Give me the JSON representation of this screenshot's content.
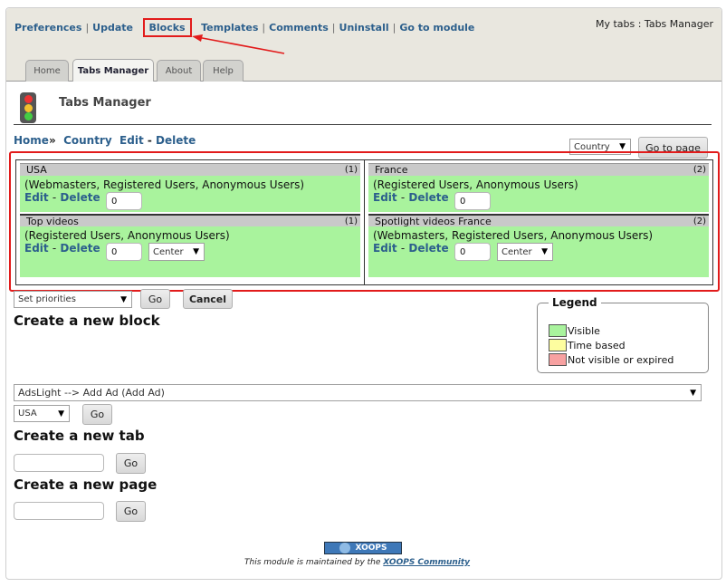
{
  "toplinks": [
    "Preferences",
    "Update",
    "Blocks",
    "Templates",
    "Comments",
    "Uninstall",
    "Go to module"
  ],
  "mytabs": "My tabs : Tabs Manager",
  "tabs": [
    "Home",
    "Tabs Manager",
    "About",
    "Help"
  ],
  "page_title": "Tabs Manager",
  "breadcrumb": {
    "home": "Home",
    "sep": "»",
    "country": "Country",
    "edit": "Edit",
    "dash": "-",
    "delete": "Delete"
  },
  "go_select": {
    "value": "Country",
    "button": "Go to page"
  },
  "blocks": {
    "left": [
      {
        "name": "USA",
        "count": "(1)",
        "groups": "(Webmasters, Registered Users, Anonymous Users)",
        "weight": "0",
        "edit": "Edit",
        "dash": "-",
        "delete": "Delete"
      },
      {
        "name": "Top videos",
        "count": "(1)",
        "groups": "(Registered Users, Anonymous Users)",
        "weight": "0",
        "position": "Center",
        "edit": "Edit",
        "dash": "-",
        "delete": "Delete"
      }
    ],
    "right": [
      {
        "name": "France",
        "count": "(2)",
        "groups": "(Registered Users, Anonymous Users)",
        "weight": "0",
        "edit": "Edit",
        "dash": "-",
        "delete": "Delete"
      },
      {
        "name": "Spotlight videos France",
        "count": "(2)",
        "groups": "(Webmasters, Registered Users, Anonymous Users)",
        "weight": "0",
        "position": "Center",
        "edit": "Edit",
        "dash": "-",
        "delete": "Delete"
      }
    ]
  },
  "priorities": {
    "select": "Set priorities",
    "go": "Go",
    "cancel": "Cancel"
  },
  "legend": {
    "title": "Legend",
    "items": [
      {
        "label": "Visible",
        "color": "#a9f39d"
      },
      {
        "label": "Time based",
        "color": "#fdfd9f"
      },
      {
        "label": "Not visible or expired",
        "color": "#f7a1a1"
      }
    ]
  },
  "new_block": {
    "title": "Create a new block",
    "select": "AdsLight --> Add Ad (Add Ad)",
    "country": "USA",
    "go": "Go"
  },
  "new_tab": {
    "title": "Create a new tab",
    "go": "Go"
  },
  "new_page": {
    "title": "Create a new page",
    "go": "Go"
  },
  "footer": {
    "logo": "XOOPS",
    "text": "This module is maintained by the",
    "link": "XOOPS Community"
  },
  "colors": {
    "link": "#2c5f8c",
    "highlight": "#e21b1b"
  }
}
